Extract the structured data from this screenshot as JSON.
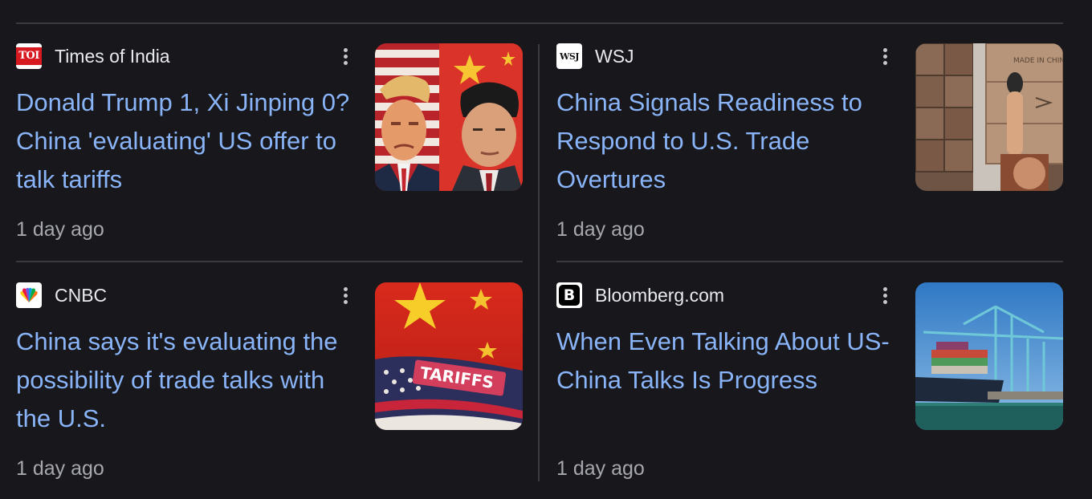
{
  "articles": [
    {
      "source": "Times of India",
      "favicon_text": "TOI",
      "headline": "Donald Trump 1, Xi Jinping 0? China 'evaluating' US offer to talk tariffs",
      "time": "1 day ago"
    },
    {
      "source": "WSJ",
      "favicon_text": "WSJ",
      "headline": "China Signals Readiness to Respond to U.S. Trade Overtures",
      "time": "1 day ago"
    },
    {
      "source": "CNBC",
      "favicon_text": "",
      "headline": "China says it's evaluating the possibility of trade talks with the U.S.",
      "time": "1 day ago",
      "thumb_text": "TARIFFS"
    },
    {
      "source": "Bloomberg.com",
      "favicon_text": "B",
      "headline": "When Even Talking About US-China Talks Is Progress",
      "time": "1 day ago"
    }
  ],
  "colors": {
    "background": "#17171c",
    "headline": "#8ab4f8",
    "source": "#e8eaed",
    "meta": "#a6a8ad",
    "divider": "#3a3b40"
  },
  "icons": [
    "more-vert-icon"
  ]
}
